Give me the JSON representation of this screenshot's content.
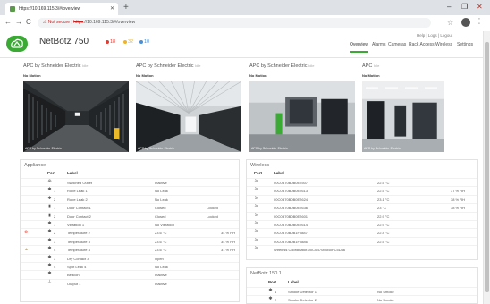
{
  "browser": {
    "tab_title": "https://10.169.115.3/#/overview",
    "new_tab": "+",
    "win_min": "–",
    "win_max": "❐",
    "win_close": "✕",
    "nav_back": "←",
    "nav_forward": "→",
    "nav_reload": "C",
    "url_warning": "⚠ Not secure",
    "url_scheme": "https",
    "url_rest": "://10.169.115.3/#/overview",
    "star": "☆",
    "menu": "⋮"
  },
  "app": {
    "title": "NetBotz 750",
    "alarms": [
      {
        "count": "18",
        "color": "#e03c31"
      },
      {
        "count": "32",
        "color": "#f0b429"
      },
      {
        "count": "10",
        "color": "#4a90d9"
      }
    ],
    "util_links": "Help  |  Logs  |  Logout",
    "nav": [
      {
        "label": "Overview",
        "active": true
      },
      {
        "label": "Alarms"
      },
      {
        "label": "Cameras"
      },
      {
        "label": "Rack Access"
      },
      {
        "label": "Wireless"
      },
      {
        "label": "Settings"
      }
    ]
  },
  "cameras": [
    {
      "title": "APC by Schneider Electric",
      "sub": "Idle",
      "motion": "No Motion",
      "overlay": "APC by Schneider Electric"
    },
    {
      "title": "APC by Schneider Electric",
      "sub": "Idle",
      "motion": "No Motion",
      "overlay": "APC by Schneider Electric"
    },
    {
      "title": "APC by Schneider Electric",
      "sub": "Idle",
      "motion": "No Motion",
      "overlay": "APC by Schneider Electric"
    },
    {
      "title": "APC",
      "sub": "Idle",
      "motion": "No Motion",
      "overlay": "APC by Schneider Electric"
    }
  ],
  "appliance": {
    "title": "Appliance",
    "headers": {
      "port": "Port",
      "label": "Label"
    },
    "rows": [
      {
        "alarm": "",
        "icon": "⊕",
        "port": "",
        "label": "Switched Outlet",
        "value": "Inactive",
        "extra": "",
        "humidity": ""
      },
      {
        "alarm": "",
        "icon": "✱",
        "port": "1",
        "label": "Rope Leak 1",
        "value": "No Leak",
        "extra": "",
        "humidity": ""
      },
      {
        "alarm": "",
        "icon": "✱",
        "port": "2",
        "label": "Rope Leak 2",
        "value": "No Leak",
        "extra": "",
        "humidity": ""
      },
      {
        "alarm": "",
        "icon": "▮",
        "port": "1",
        "label": "Door Contact 1",
        "value": "Closed",
        "extra": "Locked",
        "humidity": ""
      },
      {
        "alarm": "",
        "icon": "▮",
        "port": "2",
        "label": "Door Contact 2",
        "value": "Closed",
        "extra": "Locked",
        "humidity": ""
      },
      {
        "alarm": "",
        "icon": "✱",
        "port": "1",
        "label": "Vibration 1",
        "value": "No Vibration",
        "extra": "",
        "humidity": ""
      },
      {
        "alarm": "⊗",
        "alarm_color": "#e03c31",
        "icon": "✱",
        "port": "2",
        "label": "Temperature 2",
        "value": "23.6 °C",
        "extra": "",
        "humidity": "34 % RH"
      },
      {
        "alarm": "",
        "icon": "✱",
        "port": "3",
        "label": "Temperature 3",
        "value": "23.6 °C",
        "extra": "",
        "humidity": "34 % RH"
      },
      {
        "alarm": "▲",
        "alarm_color": "#f0b429",
        "icon": "✱",
        "port": "4",
        "label": "Temperature 4",
        "value": "23.6 °C",
        "extra": "",
        "humidity": "31 % RH"
      },
      {
        "alarm": "",
        "icon": "✱",
        "port": "3",
        "label": "Dry Contact 3",
        "value": "Open",
        "extra": "",
        "humidity": ""
      },
      {
        "alarm": "",
        "icon": "✱",
        "port": "4",
        "label": "Spot Leak 4",
        "value": "No Leak",
        "extra": "",
        "humidity": ""
      },
      {
        "alarm": "",
        "icon": "✱",
        "port": "",
        "label": "Beacon",
        "value": "Inactive",
        "extra": "",
        "humidity": ""
      },
      {
        "alarm": "",
        "icon": "⏚",
        "port": "",
        "label": "Output 1",
        "value": "Inactive",
        "extra": "",
        "humidity": ""
      }
    ]
  },
  "wireless": {
    "title": "Wireless",
    "headers": {
      "port": "Port",
      "label": "Label"
    },
    "rows": [
      {
        "label": "00C0B70B0B0E2507",
        "value": "22.5 °C",
        "humidity": ""
      },
      {
        "label": "00C0B70B0B0E2613",
        "value": "22.5 °C",
        "humidity": "37 % RH"
      },
      {
        "label": "00C0B70B0B0E2624",
        "value": "23.1 °C",
        "humidity": "38 % RH"
      },
      {
        "label": "00C0B70B0B0E2636",
        "value": "23 °C",
        "humidity": "38 % RH"
      },
      {
        "label": "00C0B70B0B0E2601",
        "value": "22.9 °C",
        "humidity": ""
      },
      {
        "label": "00C0B70B0B0E2614",
        "value": "22.9 °C",
        "humidity": ""
      },
      {
        "label": "00C0B70B0B1F0887",
        "value": "22.4 °C",
        "humidity": ""
      },
      {
        "label": "00C0B70B0B1F0886",
        "value": "22.5 °C",
        "humidity": ""
      },
      {
        "label": "Wireless Coordinator-00C0B70B0B0FC5D46",
        "value": "",
        "humidity": ""
      }
    ]
  },
  "netbotz150": {
    "title": "NetBotz 150 1",
    "headers": {
      "port": "Port",
      "label": "Label"
    },
    "rows": [
      {
        "port": "1",
        "label": "Smoke Detector 1",
        "value": "No Smoke"
      },
      {
        "port": "2",
        "label": "Smoke Detector 2",
        "value": "No Smoke"
      }
    ]
  }
}
